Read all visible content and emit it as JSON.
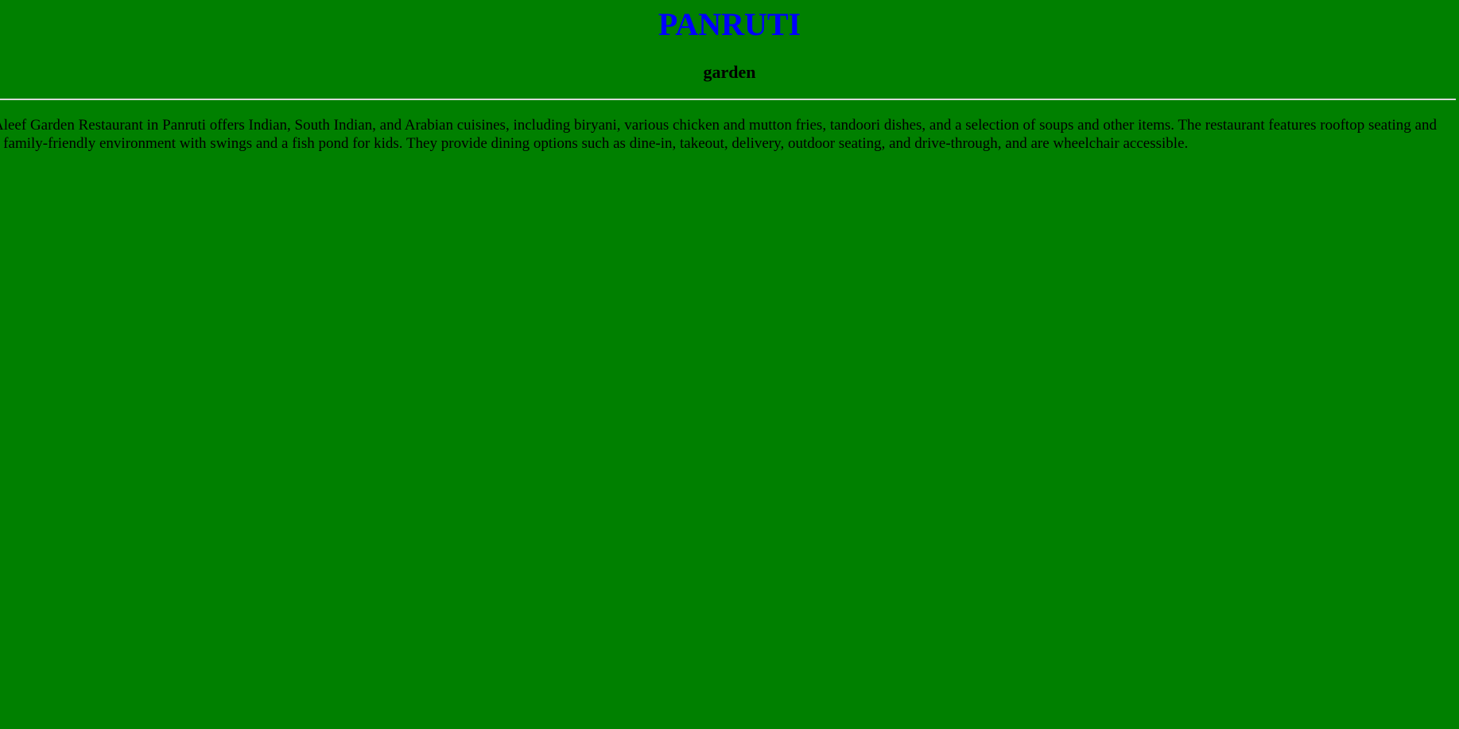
{
  "page": {
    "title": "PANRUTI",
    "subtitle": "garden",
    "description": "Aleef Garden Restaurant in Panruti offers Indian, South Indian, and Arabian cuisines, including biryani, various chicken and mutton fries, tandoori dishes, and a selection of soups and other items. The restaurant features rooftop seating and a family-friendly environment with swings and a fish pond for kids. They provide dining options such as dine-in, takeout, delivery, outdoor seating, and drive-through, and are wheelchair accessible."
  },
  "colors": {
    "background": "#008000",
    "title": "#0000ff",
    "text": "#000000",
    "divider": "#d9d9d9"
  }
}
